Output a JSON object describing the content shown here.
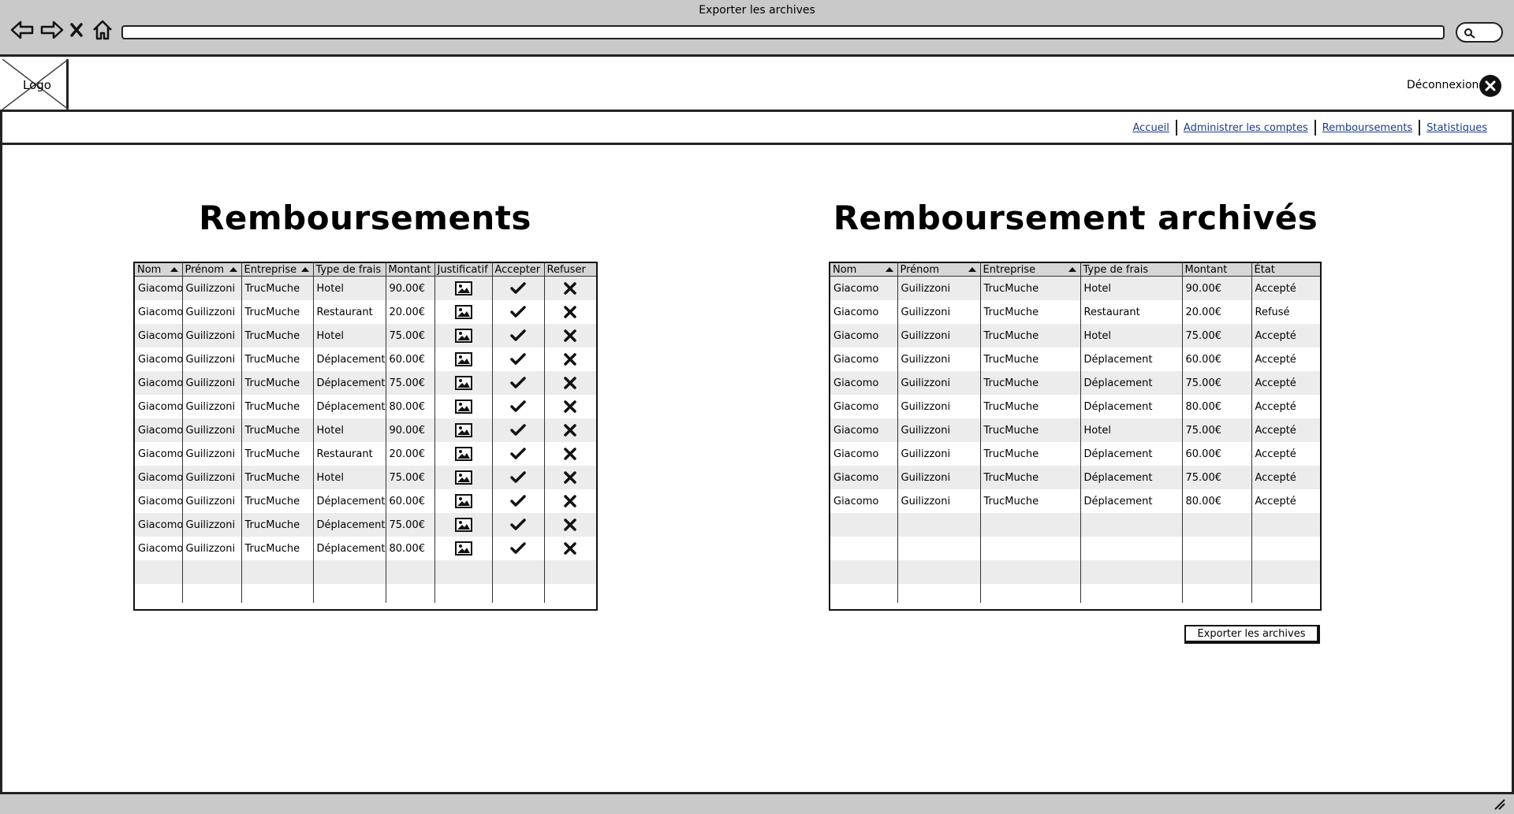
{
  "browser": {
    "window_title": "Exporter les archives",
    "icons": [
      "back-arrow-icon",
      "forward-arrow-icon",
      "close-icon",
      "home-icon",
      "search-icon"
    ]
  },
  "header": {
    "logo_text": "Logo",
    "logout_label": "Déconnexion",
    "logout_icon": "close-circle-icon"
  },
  "nav": {
    "links": [
      "Accueil",
      "Administrer les comptes",
      "Remboursements",
      "Statistiques"
    ]
  },
  "left": {
    "title": "Remboursements",
    "columns": [
      "Nom",
      "Prénom",
      "Entreprise",
      "Type de frais",
      "Montant",
      "Justificatif",
      "Accepter",
      "Refuser"
    ],
    "sortable_columns": [
      "Nom",
      "Prénom",
      "Entreprise"
    ],
    "rows": [
      {
        "nom": "Giacomo",
        "prenom": "Guilizzoni",
        "entreprise": "TrucMuche",
        "type": "Hotel",
        "montant": "90.00€"
      },
      {
        "nom": "Giacomo",
        "prenom": "Guilizzoni",
        "entreprise": "TrucMuche",
        "type": "Restaurant",
        "montant": "20.00€"
      },
      {
        "nom": "Giacomo",
        "prenom": "Guilizzoni",
        "entreprise": "TrucMuche",
        "type": "Hotel",
        "montant": "75.00€"
      },
      {
        "nom": "Giacomo",
        "prenom": "Guilizzoni",
        "entreprise": "TrucMuche",
        "type": "Déplacement",
        "montant": "60.00€"
      },
      {
        "nom": "Giacomo",
        "prenom": "Guilizzoni",
        "entreprise": "TrucMuche",
        "type": "Déplacement",
        "montant": "75.00€"
      },
      {
        "nom": "Giacomo",
        "prenom": "Guilizzoni",
        "entreprise": "TrucMuche",
        "type": "Déplacement",
        "montant": "80.00€"
      },
      {
        "nom": "Giacomo",
        "prenom": "Guilizzoni",
        "entreprise": "TrucMuche",
        "type": "Hotel",
        "montant": "90.00€"
      },
      {
        "nom": "Giacomo",
        "prenom": "Guilizzoni",
        "entreprise": "TrucMuche",
        "type": "Restaurant",
        "montant": "20.00€"
      },
      {
        "nom": "Giacomo",
        "prenom": "Guilizzoni",
        "entreprise": "TrucMuche",
        "type": "Hotel",
        "montant": "75.00€"
      },
      {
        "nom": "Giacomo",
        "prenom": "Guilizzoni",
        "entreprise": "TrucMuche",
        "type": "Déplacement",
        "montant": "60.00€"
      },
      {
        "nom": "Giacomo",
        "prenom": "Guilizzoni",
        "entreprise": "TrucMuche",
        "type": "Déplacement",
        "montant": "75.00€"
      },
      {
        "nom": "Giacomo",
        "prenom": "Guilizzoni",
        "entreprise": "TrucMuche",
        "type": "Déplacement",
        "montant": "80.00€"
      }
    ],
    "empty_rows": 2,
    "row_icons": {
      "justificatif": "image-icon",
      "accepter": "checkmark-icon",
      "refuser": "cross-icon"
    }
  },
  "right": {
    "title": "Remboursement archivés",
    "columns": [
      "Nom",
      "Prénom",
      "Entreprise",
      "Type de frais",
      "Montant",
      "État"
    ],
    "sortable_columns": [
      "Nom",
      "Prénom",
      "Entreprise"
    ],
    "rows": [
      {
        "nom": "Giacomo",
        "prenom": "Guilizzoni",
        "entreprise": "TrucMuche",
        "type": "Hotel",
        "montant": "90.00€",
        "etat": "Accepté"
      },
      {
        "nom": "Giacomo",
        "prenom": "Guilizzoni",
        "entreprise": "TrucMuche",
        "type": "Restaurant",
        "montant": "20.00€",
        "etat": "Refusé"
      },
      {
        "nom": "Giacomo",
        "prenom": "Guilizzoni",
        "entreprise": "TrucMuche",
        "type": "Hotel",
        "montant": "75.00€",
        "etat": "Accepté"
      },
      {
        "nom": "Giacomo",
        "prenom": "Guilizzoni",
        "entreprise": "TrucMuche",
        "type": "Déplacement",
        "montant": "60.00€",
        "etat": "Accepté"
      },
      {
        "nom": "Giacomo",
        "prenom": "Guilizzoni",
        "entreprise": "TrucMuche",
        "type": "Déplacement",
        "montant": "75.00€",
        "etat": "Accepté"
      },
      {
        "nom": "Giacomo",
        "prenom": "Guilizzoni",
        "entreprise": "TrucMuche",
        "type": "Déplacement",
        "montant": "80.00€",
        "etat": "Accepté"
      },
      {
        "nom": "Giacomo",
        "prenom": "Guilizzoni",
        "entreprise": "TrucMuche",
        "type": "Hotel",
        "montant": "75.00€",
        "etat": "Accepté"
      },
      {
        "nom": "Giacomo",
        "prenom": "Guilizzoni",
        "entreprise": "TrucMuche",
        "type": "Déplacement",
        "montant": "60.00€",
        "etat": "Accepté"
      },
      {
        "nom": "Giacomo",
        "prenom": "Guilizzoni",
        "entreprise": "TrucMuche",
        "type": "Déplacement",
        "montant": "75.00€",
        "etat": "Accepté"
      },
      {
        "nom": "Giacomo",
        "prenom": "Guilizzoni",
        "entreprise": "TrucMuche",
        "type": "Déplacement",
        "montant": "80.00€",
        "etat": "Accepté"
      }
    ],
    "empty_rows": 4,
    "export_button": "Exporter les archives"
  },
  "footer": {
    "grip_icon": "resize-grip-icon"
  }
}
